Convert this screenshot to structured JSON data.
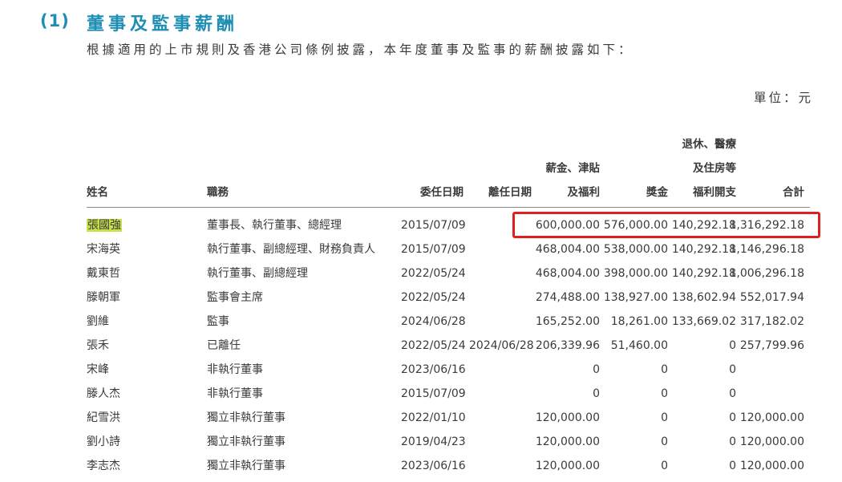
{
  "section": {
    "number": "(1)",
    "title": "董事及監事薪酬",
    "intro": "根據適用的上市規則及香港公司條例披露，本年度董事及監事的薪酬披露如下：",
    "unit": "單位：元"
  },
  "headers": {
    "name": "姓名",
    "position": "職務",
    "appointed": "委任日期",
    "resigned": "離任日期",
    "salary": [
      "薪金、津貼",
      "及福利"
    ],
    "bonus": "獎金",
    "pension": [
      "退休、醫療",
      "及住房等",
      "福利開支"
    ],
    "total": "合計"
  },
  "rows": [
    {
      "name": "張國強",
      "position": "董事長、執行董事、總經理",
      "appointed": "2015/07/09",
      "resigned": "",
      "salary": "600,000.00",
      "bonus": "576,000.00",
      "pension": "140,292.18",
      "total": "1,316,292.18"
    },
    {
      "name": "宋海英",
      "position": "執行董事、副總經理、財務負責人",
      "appointed": "2015/07/09",
      "resigned": "",
      "salary": "468,004.00",
      "bonus": "538,000.00",
      "pension": "140,292.18",
      "total": "1,146,296.18"
    },
    {
      "name": "戴東哲",
      "position": "執行董事、副總經理",
      "appointed": "2022/05/24",
      "resigned": "",
      "salary": "468,004.00",
      "bonus": "398,000.00",
      "pension": "140,292.18",
      "total": "1,006,296.18"
    },
    {
      "name": "滕朝軍",
      "position": "監事會主席",
      "appointed": "2022/05/24",
      "resigned": "",
      "salary": "274,488.00",
      "bonus": "138,927.00",
      "pension": "138,602.94",
      "total": "552,017.94"
    },
    {
      "name": "劉維",
      "position": "監事",
      "appointed": "2024/06/28",
      "resigned": "",
      "salary": "165,252.00",
      "bonus": "18,261.00",
      "pension": "133,669.02",
      "total": "317,182.02"
    },
    {
      "name": "張禾",
      "position": "已離任",
      "appointed": "2022/05/24",
      "resigned": "2024/06/28",
      "salary": "206,339.96",
      "bonus": "51,460.00",
      "pension": "0",
      "total": "257,799.96"
    },
    {
      "name": "宋峰",
      "position": "非執行董事",
      "appointed": "2023/06/16",
      "resigned": "",
      "salary": "0",
      "bonus": "0",
      "pension": "0",
      "total": ""
    },
    {
      "name": "滕人杰",
      "position": "非執行董事",
      "appointed": "2015/07/09",
      "resigned": "",
      "salary": "0",
      "bonus": "0",
      "pension": "0",
      "total": ""
    },
    {
      "name": "紀雪洪",
      "position": "獨立非執行董事",
      "appointed": "2022/01/10",
      "resigned": "",
      "salary": "120,000.00",
      "bonus": "0",
      "pension": "0",
      "total": "120,000.00"
    },
    {
      "name": "劉小詩",
      "position": "獨立非執行董事",
      "appointed": "2019/04/23",
      "resigned": "",
      "salary": "120,000.00",
      "bonus": "0",
      "pension": "0",
      "total": "120,000.00"
    },
    {
      "name": "李志杰",
      "position": "獨立非執行董事",
      "appointed": "2023/06/16",
      "resigned": "",
      "salary": "120,000.00",
      "bonus": "0",
      "pension": "0",
      "total": "120,000.00"
    }
  ],
  "colors": {
    "accent": "#1e8fb4",
    "highlight": "#c6e14a",
    "annotation_box": "#e02020"
  }
}
